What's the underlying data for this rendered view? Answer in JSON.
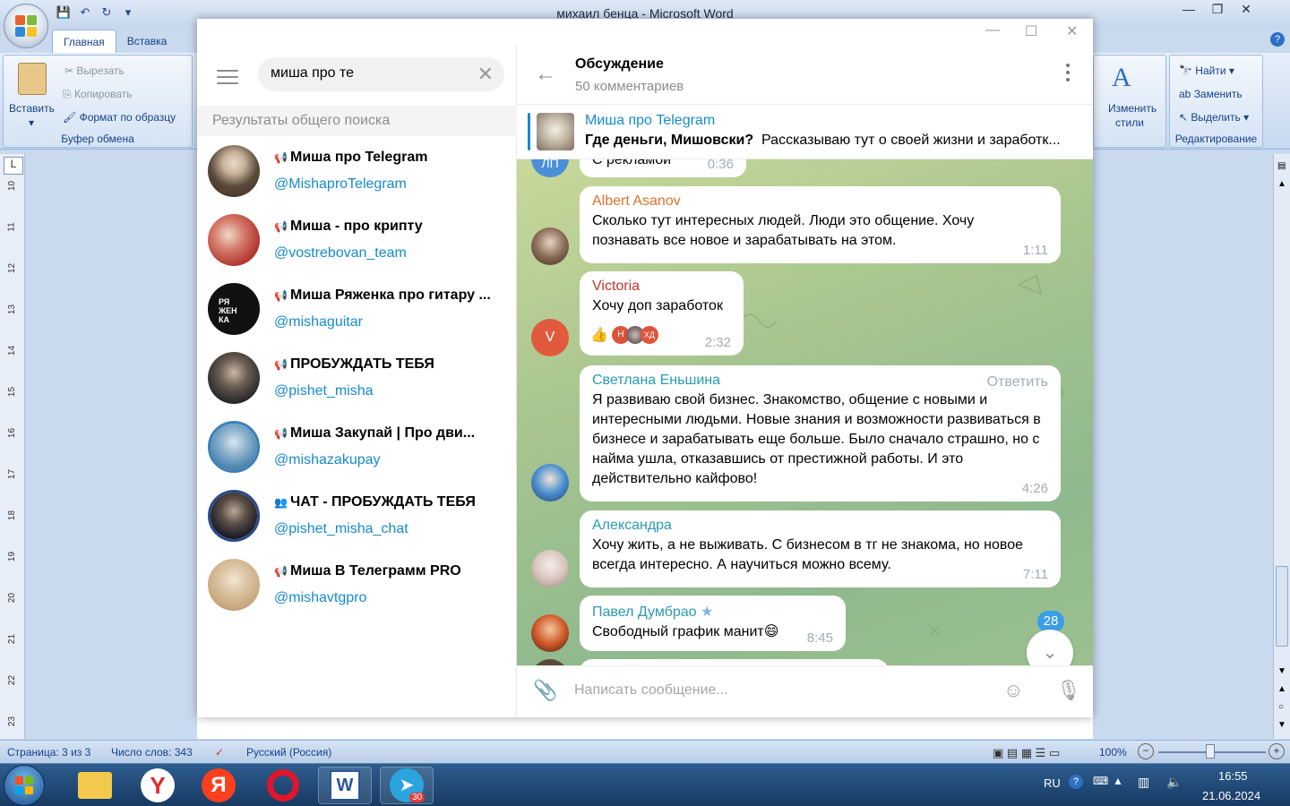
{
  "word": {
    "title": "михаил бенца - Microsoft Word",
    "tabs": [
      "Главная",
      "Вставка"
    ],
    "clipboard": {
      "paste": "Вставить",
      "cut": "Вырезать",
      "copy": "Копировать",
      "format_painter": "Формат по образцу",
      "group": "Буфер обмена"
    },
    "styles": {
      "change": "Изменить",
      "styles": "стили"
    },
    "editing": {
      "find": "Найти",
      "replace": "Заменить",
      "select": "Выделить",
      "group": "Редактирование"
    },
    "ruler_numbers": [
      "10",
      "11",
      "12",
      "13",
      "14",
      "15",
      "16",
      "17",
      "18",
      "19",
      "20",
      "21",
      "22",
      "23"
    ],
    "status": {
      "page": "Страница: 3 из 3",
      "words": "Число слов: 343",
      "language": "Русский (Россия)",
      "zoom": "100%"
    }
  },
  "telegram": {
    "search_value": "миша про те",
    "results_header": "Результаты общего поиска",
    "results": [
      {
        "name": "Миша про Telegram",
        "username": "@MishaproTelegram",
        "kind": "channel",
        "avatar_color": "#5a4a3a"
      },
      {
        "name": "Миша - про крипту",
        "username": "@vostrebovan_team",
        "kind": "channel",
        "avatar_color": "#b4392f"
      },
      {
        "name": "Миша Ряженка про гитару ...",
        "username": "@mishaguitar",
        "kind": "channel",
        "avatar_color": "#111111"
      },
      {
        "name": "ПРОБУЖДАТЬ ТЕБЯ",
        "username": "@pishet_misha",
        "kind": "channel",
        "avatar_color": "#2c2c2c"
      },
      {
        "name": "Миша Закупай | Про дви...",
        "username": "@mishazakupay",
        "kind": "channel",
        "avatar_color": "#3b7fb8"
      },
      {
        "name": "ЧАТ - ПРОБУЖДАТЬ ТЕБЯ",
        "username": "@pishet_misha_chat",
        "kind": "group",
        "avatar_color": "#1e1e2a"
      },
      {
        "name": "Миша В Телеграмм PRO",
        "username": "@mishavtgpro",
        "kind": "channel",
        "avatar_color": "#c9a77d"
      }
    ],
    "avatar_letter_text": "РЯ ЖЕН КА",
    "chat": {
      "title": "Обсуждение",
      "subtitle": "50 комментариев",
      "pinned_title": "Миша про Telegram",
      "pinned_bold": "Где деньги, Мишовски?",
      "pinned_text": "Рассказываю тут о своей жизни и заработк...",
      "top_partial": {
        "text": "С рекламой",
        "time": "0:36"
      },
      "messages": [
        {
          "author": "Albert Asanov",
          "color": "#d9722d",
          "text": "Сколько тут интересных людей. Люди это общение. Хочу познавать все новое и зарабатывать на этом.",
          "time": "1:11"
        },
        {
          "author": "Victoria",
          "color": "#c0392b",
          "text": "Хочу доп заработок",
          "time": "2:32",
          "avatar_letter": "V",
          "reactions": [
            "Н",
            "ХД"
          ]
        },
        {
          "author": "Светлана Еньшина",
          "color": "#2a9bb0",
          "text": "Я развиваю свой бизнес. Знакомство, общение с новыми и интересными людьми. Новые знания и возможности развиваться в бизнесе и зарабатывать еще больше. Было сначало страшно, но с найма ушла, отказавшись от престижной работы. И это действительно кайфово!",
          "time": "4:26",
          "reply": "Ответить"
        },
        {
          "author": "Александра",
          "color": "#2a9bb0",
          "text": "Хочу жить, а не выживать. С бизнесом в тг не знакома, но новое всегда интересно. А научиться можно всему.",
          "time": "7:11"
        },
        {
          "author": "Павел Думбрао",
          "color": "#2a9bb0",
          "text": "Свободный график манит",
          "time": "8:45"
        }
      ],
      "unread_count": "28",
      "input_placeholder": "Написать сообщение..."
    }
  },
  "taskbar": {
    "lang": "RU",
    "time": "16:55",
    "date": "21.06.2024",
    "telegram_badge": "30"
  }
}
